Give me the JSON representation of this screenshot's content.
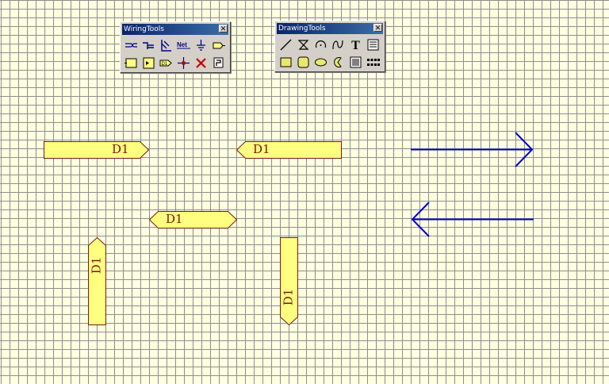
{
  "wiring_tools": {
    "title": "WiringTools",
    "close_glyph": "✕",
    "net_label": "Net",
    "d1_label": "D1",
    "buttons": [
      "wire-icon",
      "bus-icon",
      "bus-entry-icon",
      "net-label-icon",
      "ground-power-icon",
      "port-icon",
      "sheet-symbol-icon",
      "sheet-entry-icon",
      "part-icon",
      "junction-icon",
      "no-erc-icon",
      "pcb-layout-directive-icon"
    ]
  },
  "drawing_tools": {
    "title": "DrawingTools",
    "close_glyph": "✕",
    "text_glyph": "T",
    "buttons": [
      "line-icon",
      "polygon-icon",
      "arc-icon",
      "bezier-icon",
      "text-icon",
      "text-frame-icon",
      "rectangle-icon",
      "rounded-rectangle-icon",
      "ellipse-icon",
      "pie-icon",
      "graphic-icon",
      "paste-array-icon"
    ]
  },
  "ports": [
    {
      "label": "D1",
      "orientation": "right"
    },
    {
      "label": "D1",
      "orientation": "left"
    },
    {
      "label": "D1",
      "orientation": "left-right"
    },
    {
      "label": "D1",
      "orientation": "up"
    },
    {
      "label": "D1",
      "orientation": "down"
    }
  ],
  "arrows": [
    {
      "direction": "right"
    },
    {
      "direction": "left"
    }
  ],
  "colors": {
    "port_fill": "#FFFF80",
    "port_border": "#7A1616",
    "port_text": "#7A1616",
    "arrow": "#0000CC",
    "grid_background": "#FFFFE1",
    "grid_line": "#8E8E8E"
  }
}
